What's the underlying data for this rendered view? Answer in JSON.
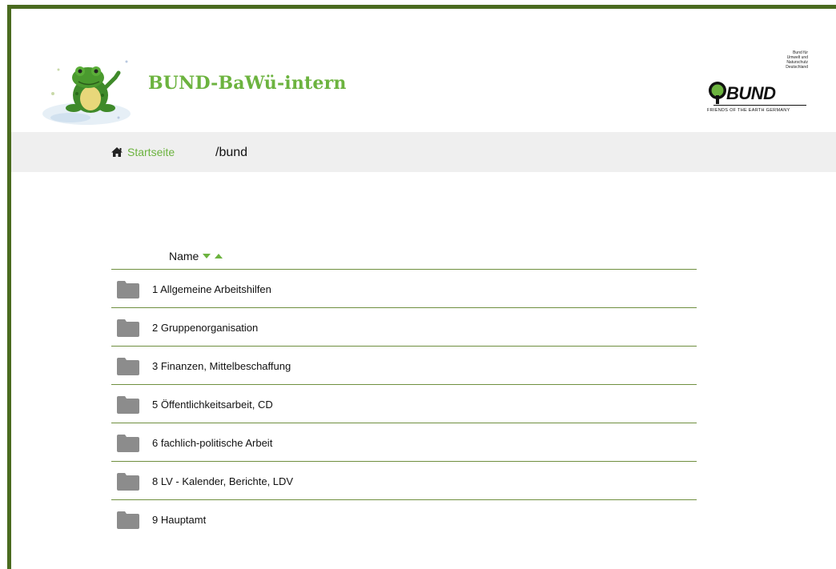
{
  "header": {
    "site_title": "BUND-BaWü-intern",
    "logo": {
      "small_lines": [
        "Bund für",
        "Umwelt und",
        "Naturschutz",
        "Deutschland"
      ],
      "wordmark": "BUND",
      "subtitle": "FRIENDS OF THE EARTH GERMANY"
    }
  },
  "breadcrumb": {
    "home_label": "Startseite",
    "path": "/bund",
    "home_icon": "home-icon"
  },
  "file_list": {
    "column_name": "Name",
    "items": [
      {
        "name": "1 Allgemeine Arbeitshilfen",
        "icon": "folder-icon"
      },
      {
        "name": "2 Gruppenorganisation",
        "icon": "folder-icon"
      },
      {
        "name": "3 Finanzen, Mittelbeschaffung",
        "icon": "folder-icon"
      },
      {
        "name": "5 Öffentlichkeitsarbeit, CD",
        "icon": "folder-icon"
      },
      {
        "name": "6 fachlich-politische Arbeit",
        "icon": "folder-icon"
      },
      {
        "name": "8 LV - Kalender, Berichte, LDV",
        "icon": "folder-icon"
      },
      {
        "name": "9 Hauptamt",
        "icon": "folder-icon"
      }
    ]
  },
  "colors": {
    "brand_green": "#6cb33f",
    "frame_green": "#4a6b1f",
    "folder_gray": "#8c8c8c",
    "breadcrumb_bg": "#efefef"
  }
}
